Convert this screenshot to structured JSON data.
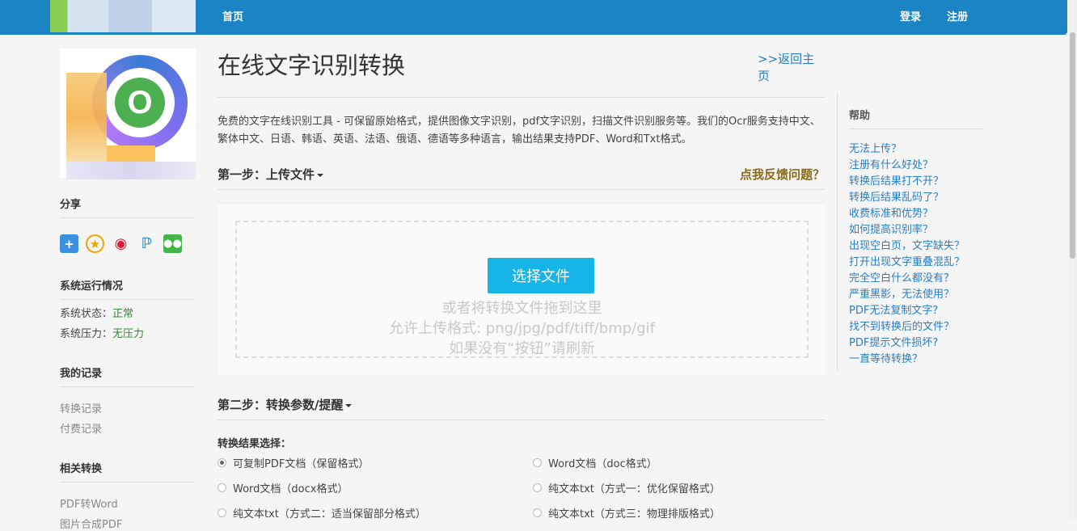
{
  "colors": {
    "topbar": "#1b84c4",
    "link": "#2a7dc4",
    "accent_button": "#17b4e8",
    "feedback": "#8b6914",
    "status_ok": "#2e8b2e"
  },
  "nav": {
    "home": "首页",
    "login": "登录",
    "register": "注册"
  },
  "sidebar": {
    "share_title": "分享",
    "share_icons": [
      "plus-share-icon",
      "qzone-icon",
      "weibo-icon",
      "pinterest-icon",
      "wechat-icon"
    ],
    "system_title": "系统运行情况",
    "status_label": "系统状态：",
    "status_value": "正常",
    "pressure_label": "系统压力：",
    "pressure_value": "无压力",
    "records_title": "我的记录",
    "records": [
      "转换记录",
      "付费记录"
    ],
    "related_title": "相关转换",
    "related": [
      "PDF转Word",
      "图片合成PDF"
    ]
  },
  "main": {
    "title": "在线文字识别转换",
    "back_link": ">>返回主页",
    "intro": "免费的文字在线识别工具 - 可保留原始格式，提供图像文字识别，pdf文字识别，扫描文件识别服务等。我们的Ocr服务支持中文、繁体中文、日语、韩语、英语、法语、俄语、德语等多种语言，输出结果支持PDF、Word和Txt格式。",
    "step1_title": "第一步：上传文件",
    "feedback": "点我反馈问题？",
    "choose_button": "选择文件",
    "drop_lines": [
      "或者将转换文件拖到这里",
      "允许上传格式: png/jpg/pdf/tiff/bmp/gif",
      "如果没有“按钮”请刷新"
    ],
    "step2_title": "第二步：转换参数/提醒",
    "option_label": "转换结果选择：",
    "options": [
      "可复制PDF文档（保留格式）",
      "Word文档（doc格式）",
      "Word文档（docx格式）",
      "纯文本txt（方式一：优化保留格式）",
      "纯文本txt（方式二：适当保留部分格式）",
      "纯文本txt（方式三：物理排版格式）"
    ],
    "selected_option": 0
  },
  "help": {
    "title": "帮助",
    "items": [
      "无法上传？",
      "注册有什么好处？",
      "转换后结果打不开？",
      "转换后结果乱码了？",
      "收费标准和优势？",
      "如何提高识别率？",
      "出现空白页，文字缺失？",
      "打开出现文字重叠混乱？",
      "完全空白什么都没有？",
      "严重黑影，无法使用？",
      "PDF无法复制文字？",
      "找不到转换后的文件？",
      "PDF提示文件损坏?",
      "一直等待转换？"
    ]
  }
}
